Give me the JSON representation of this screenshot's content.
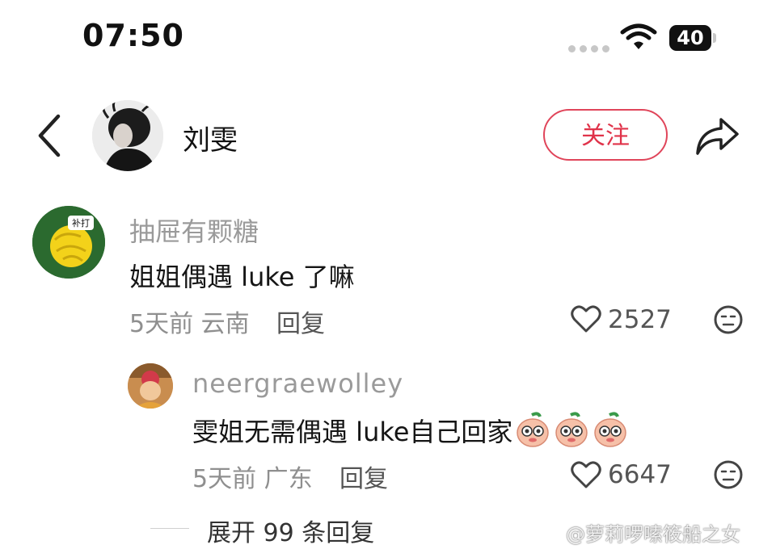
{
  "status_bar": {
    "time": "07:50",
    "battery": "40"
  },
  "header": {
    "username": "刘雯",
    "follow_label": "关注"
  },
  "comments": [
    {
      "author": "抽屉有颗糖",
      "text": "姐姐偶遇 luke 了嘛",
      "meta": "5天前 云南",
      "reply_label": "回复",
      "likes": "2527",
      "avatar_badge": "补打"
    },
    {
      "author": "neergraewolley",
      "text": "雯姐无需偶遇 luke自己回家",
      "meta": "5天前 广东",
      "reply_label": "回复",
      "likes": "6647"
    }
  ],
  "expand_label": "展开 99 条回复",
  "watermark": "@萝莉啰嗦筱船之女",
  "colors": {
    "accent": "#e0334a",
    "muted": "#8f8f8f",
    "text": "#151515"
  }
}
